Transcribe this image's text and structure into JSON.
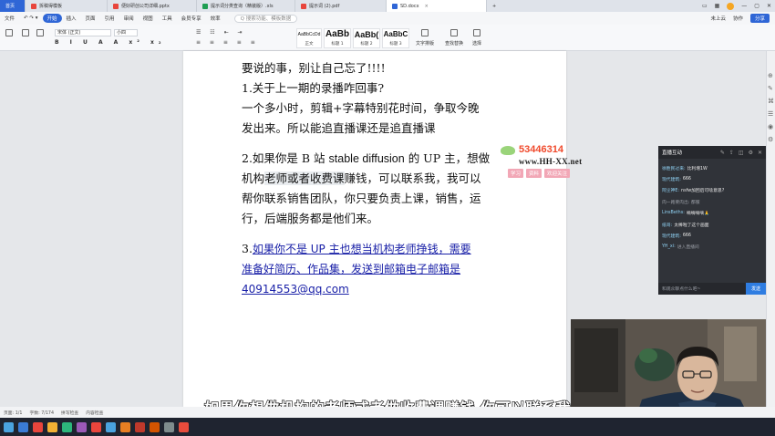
{
  "tabs": {
    "home": "首页",
    "items": [
      {
        "label": "拆稿得模板",
        "color": "#e8453c"
      },
      {
        "label": "便好研创公司详细.pptx",
        "color": "#e8453c"
      },
      {
        "label": "提示词分类查询（精装版）.xls",
        "color": "#1f9e52"
      },
      {
        "label": "提示词 (2).pdf",
        "color": "#e8453c"
      },
      {
        "label": "SD.docx",
        "color": "#2f66d6"
      }
    ],
    "add": "+"
  },
  "menu": {
    "file": "文件",
    "items": [
      "开始",
      "插入",
      "页面",
      "引用",
      "审阅",
      "视图",
      "工具",
      "会员专享",
      "效率"
    ],
    "search": "Q 搜索功能、模板数据",
    "right": [
      "未上云",
      "协作",
      "分享"
    ]
  },
  "ribbon": {
    "font": "宋体 (正文)",
    "size": "小四",
    "styles": [
      {
        "preview": "AaBbCcDd",
        "name": "正文"
      },
      {
        "preview": "AaBb",
        "name": "标题 1"
      },
      {
        "preview": "AaBb(",
        "name": "标题 2"
      },
      {
        "preview": "AaBbC",
        "name": "标题 3"
      }
    ],
    "text_tools": "文字排版",
    "find_replace": "查找替换",
    "select": "选择"
  },
  "doc": {
    "line1": "要说的事，别让自己忘了!!!!",
    "line2": "1.关于上一期的录播咋回事?",
    "line3": "一个多小时，剪辑+字幕特别花时间，争取今晚",
    "line4": "发出来。所以能追直播课还是追直播课",
    "line5a": "2.如果你是 B 站 ",
    "line5b": "stable diffusion",
    "line5c": " 的 UP 主，想做",
    "line6a": "机构",
    "line6b": "老师或者收费课",
    "line6c": "赚钱，可以联系我，我可以",
    "line7": "帮你联系销售团队，你只要负责上课，销售，运",
    "line8": "行，后端服务都是他们来。",
    "line9a": "3.",
    "line9b": "如果你不是 UP 主也想当机构老师挣钱，需要",
    "line10": "准备好简历、作品集，发送到邮箱电子邮箱是",
    "line11": "40914553@qq.com"
  },
  "watermark": {
    "number": "53446314",
    "url": "www.HH-XX.net",
    "tags": [
      "学习",
      "资料",
      "欢迎关注"
    ]
  },
  "live": {
    "title": "直播互动",
    "messages": [
      {
        "user": "徐胜民过来:",
        "text": "比利增1W"
      },
      {
        "user": "现代建筑:",
        "text": "666"
      },
      {
        "user": "阿尘神E:",
        "text": "nsfw加回后可啥意思?"
      },
      {
        "user": "",
        "text": "肉一路要肉出: 都服",
        "system": true
      },
      {
        "user": "LinsBeths:",
        "text": "嘀嘀嘀嘀🙏"
      },
      {
        "user": "纸哥:",
        "text": "太棒啦了这个画面"
      },
      {
        "user": "现代建筑:",
        "text": "666"
      },
      {
        "user": "YH_xi:",
        "text": "进入直播间",
        "system": true
      }
    ],
    "placeholder": "和观众聊点什么吧~",
    "send": "发送"
  },
  "subtitle": "如果你想做机构的老师或者做收费课赚钱 你可以联系我",
  "status": {
    "page": "页面: 1/1",
    "words": "字数: 7/174",
    "spell": "拼写检查",
    "content": "内容检查"
  },
  "taskbar_colors": [
    "#3a7bd5",
    "#e8453c",
    "#f2b134",
    "#2db67c",
    "#9b59b6",
    "#e8453c",
    "#4aa3df",
    "#e67e22",
    "#c0392b",
    "#d35400",
    "#7f8c8d",
    "#e74c3c"
  ]
}
